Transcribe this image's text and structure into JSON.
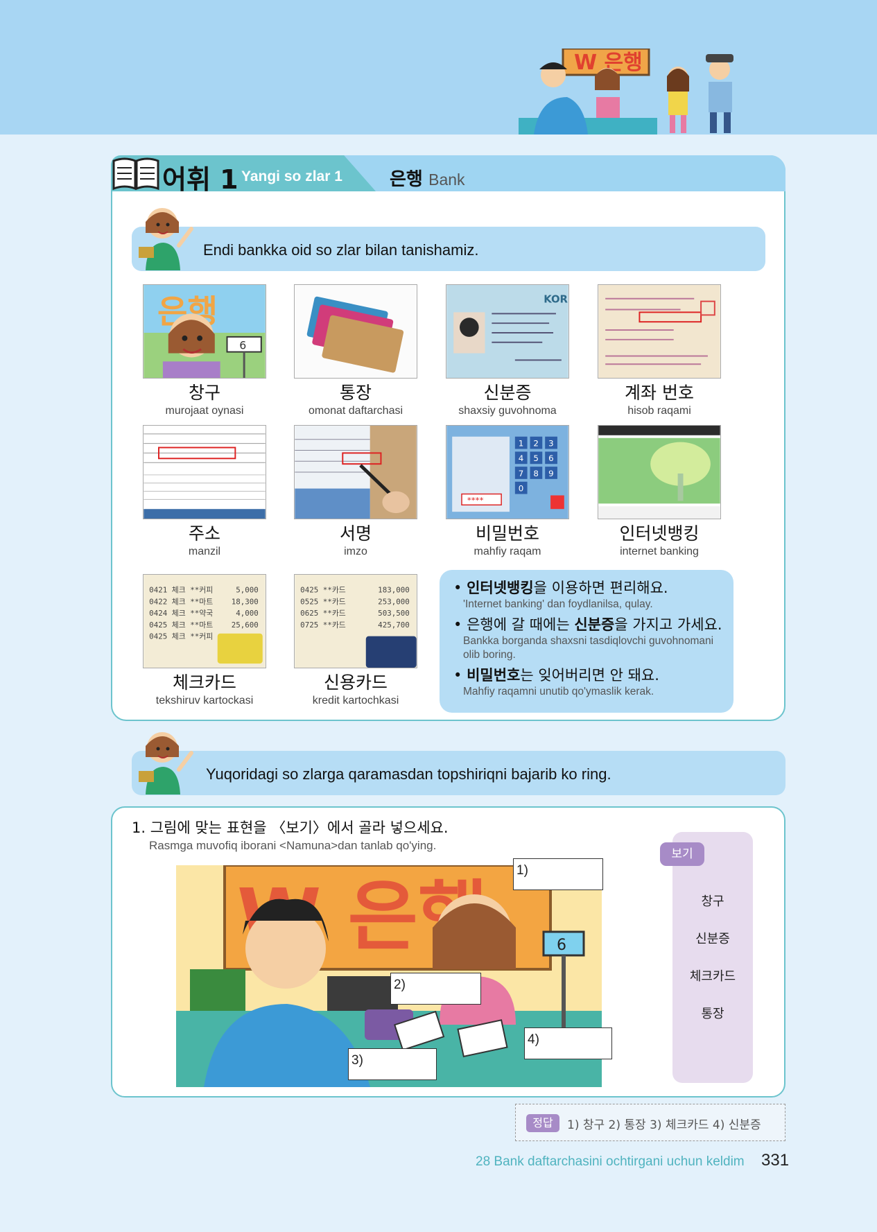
{
  "header": {
    "lesson_label": "어휘 1",
    "lesson_label_uz": "Yangi so zlar 1",
    "topic_ko": "은행",
    "topic_en": "Bank"
  },
  "intro": {
    "text": "Endi bankka oid so zlar bilan tanishamiz."
  },
  "vocab": [
    {
      "ko": "창구",
      "uz": "murojaat oynasi"
    },
    {
      "ko": "통장",
      "uz": "omonat daftarchasi"
    },
    {
      "ko": "신분증",
      "uz": "shaxsiy guvohnoma"
    },
    {
      "ko": "계좌 번호",
      "uz": "hisob raqami"
    },
    {
      "ko": "주소",
      "uz": "manzil"
    },
    {
      "ko": "서명",
      "uz": "imzo"
    },
    {
      "ko": "비밀번호",
      "uz": "mahfiy raqam"
    },
    {
      "ko": "인터넷뱅킹",
      "uz": "internet banking"
    },
    {
      "ko": "체크카드",
      "uz": "tekshiruv kartockasi"
    },
    {
      "ko": "신용카드",
      "uz": "kredit kartochkasi"
    }
  ],
  "tips": [
    {
      "bold": "인터넷뱅킹",
      "pre": "",
      "post": "을 이용하면 편리해요.",
      "uz": "'Internet banking' dan foydlanilsa, qulay."
    },
    {
      "bold": "신분증",
      "pre": "은행에 갈 때에는 ",
      "post": "을 가지고 가세요.",
      "uz": "Bankka borganda shaxsni tasdiqlovchi guvohnomani olib boring."
    },
    {
      "bold": "비밀번호",
      "pre": "",
      "post": "는 잊어버리면 안 돼요.",
      "uz": "Mahfiy raqamni unutib qo'ymaslik kerak."
    }
  ],
  "instruction": {
    "text": "Yuqoridagi so zlarga qaramasdan topshiriqni bajarib ko ring."
  },
  "exercise": {
    "question_ko": "1. 그림에 맞는 표현을 〈보기〉에서 골라 넣으세요.",
    "question_uz": "Rasmga muvofiq iborani <Namuna>dan tanlab qo'ying.",
    "blanks": [
      "1)",
      "2)",
      "3)",
      "4)"
    ],
    "choices_label": "보기",
    "choices": [
      "창구",
      "신분증",
      "체크카드",
      "통장"
    ],
    "scene_sign": "W 은행",
    "scene_counter": "6"
  },
  "answer": {
    "label": "정답",
    "text": "1) 창구  2) 통장  3) 체크카드  4) 신분증"
  },
  "footer": {
    "chapter": "28 Bank daftarchasini ochtirgani uchun keldim",
    "page": "331"
  },
  "thumbs": {
    "t1_sign": "은행",
    "t1_counter": "6",
    "t3_badge": "KOR",
    "card_rows_a": [
      [
        "0421 체크 **커피",
        "5,000"
      ],
      [
        "0422 체크 **마트",
        "18,300"
      ],
      [
        "0424 체크 **약국",
        "4,000"
      ],
      [
        "0425 체크 **마트",
        "25,600"
      ],
      [
        "0425 체크 **커피",
        ""
      ]
    ],
    "card_rows_b": [
      [
        "0425 **카드",
        "183,000"
      ],
      [
        "0525 **카드",
        "253,000"
      ],
      [
        "0625 **카드",
        "503,500"
      ],
      [
        "0725 **카드",
        "425,700"
      ]
    ],
    "pin_keys": [
      "1",
      "2",
      "3",
      "4",
      "5",
      "6",
      "7",
      "8",
      "9",
      "0"
    ],
    "pin_mask": "****"
  },
  "colors": {
    "sky": "#a8d6f3",
    "teal": "#6cc4cd",
    "bubble": "#b6ddf5",
    "purple": "#a78bc7",
    "lavender": "#e7dcee"
  }
}
